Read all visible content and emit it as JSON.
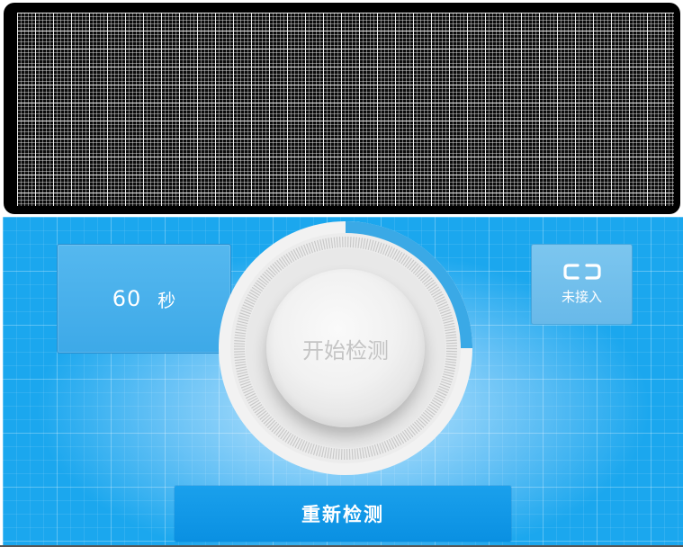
{
  "ecg_panel": {
    "grid_color": "#ffffff",
    "background_color": "#000000"
  },
  "timer": {
    "value": "60",
    "unit": "秒"
  },
  "connection": {
    "icon": "plug-disconnected-icon",
    "status": "未接入"
  },
  "dial": {
    "button_label": "开始检测",
    "progress_fraction": 0.25,
    "progress_color": "#3aa9e6"
  },
  "restart_button": {
    "label": "重新检测"
  },
  "colors": {
    "panel_background": "#1ba7ee",
    "button_primary": "#0f95e5"
  }
}
